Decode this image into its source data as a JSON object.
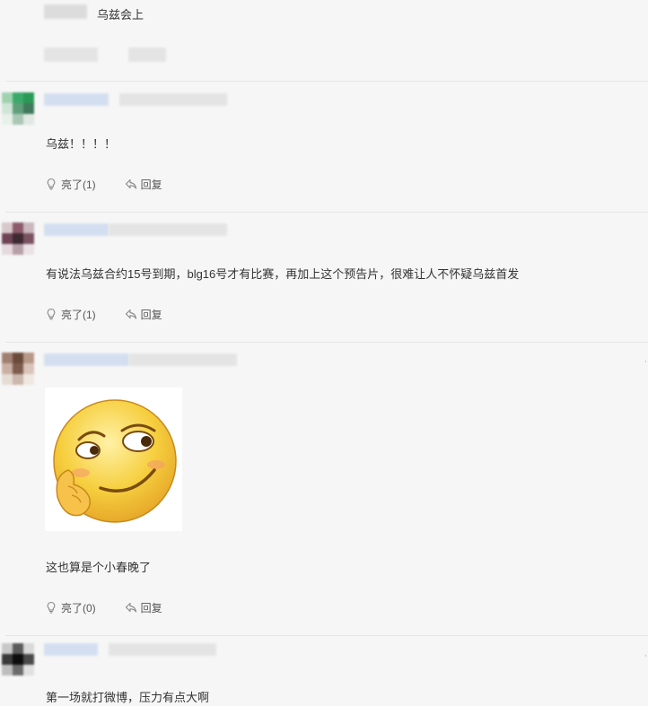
{
  "comments": [
    {
      "text": "乌兹会上"
    },
    {
      "text": "乌兹！！！！",
      "like_label": "亮了(1)",
      "reply_label": "回复"
    },
    {
      "text": "有说法乌兹合约15号到期，blg16号才有比赛，再加上这个预告片，很难让人不怀疑乌兹首发",
      "like_label": "亮了(1)",
      "reply_label": "回复"
    },
    {
      "text": "这也算是个小春晚了",
      "like_label": "亮了(0)",
      "reply_label": "回复"
    },
    {
      "text": "第一场就打微博，压力有点大啊"
    }
  ],
  "icons": {
    "like": "bulb-icon",
    "reply": "reply-arrow-icon",
    "sticker": "smirk-face-sticker"
  },
  "colors": {
    "background": "#f6f6f6",
    "divider": "#e6e6e6",
    "text": "#333333",
    "action_text": "#555555",
    "sticker_face": "#f6cf3e"
  }
}
